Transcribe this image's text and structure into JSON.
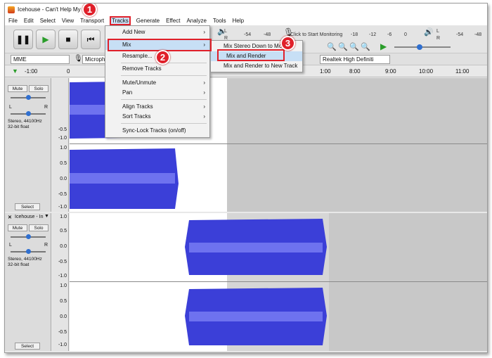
{
  "window": {
    "title": "Icehouse - Can't Help My"
  },
  "menubar": [
    "File",
    "Edit",
    "Select",
    "View",
    "Transport",
    "Tracks",
    "Generate",
    "Effect",
    "Analyze",
    "Tools",
    "Help"
  ],
  "toolbar": {
    "pause_icon": "pause-icon",
    "play_icon": "play-icon",
    "stop_icon": "stop-icon",
    "skip_start_icon": "skip-start-icon",
    "meter_labels": [
      "L",
      "R"
    ],
    "meter_ticks": [
      "-54",
      "-48",
      "-18",
      "-12",
      "-6",
      "0"
    ],
    "meter_ticks_right": [
      "-54",
      "-48"
    ],
    "monitor_text": "Click to Start Monitoring"
  },
  "device_bar": {
    "host": "MME",
    "mic_input": "Microph",
    "output_device": "Realtek High Definiti"
  },
  "ruler": {
    "start": "-1:00",
    "marks": [
      "0",
      "8:00",
      "9:00",
      "10:00",
      "11:00",
      "1:00"
    ]
  },
  "track1": {
    "mute": "Mute",
    "solo": "Solo",
    "pan_l": "L",
    "pan_r": "R",
    "info": "Stereo, 44100Hz\n32-bit float",
    "select": "Select",
    "scale_top": [
      "-0.5",
      "-1.0"
    ],
    "scale_bottom": [
      "1.0",
      "0.5",
      "0.0",
      "-0.5",
      "-1.0"
    ]
  },
  "track2": {
    "name": "Icehouse - In",
    "mute": "Mute",
    "solo": "Solo",
    "pan_l": "L",
    "pan_r": "R",
    "info": "Stereo, 44100Hz\n32-bit float",
    "select": "Select",
    "scale_top": [
      "1.0",
      "0.5",
      "0.0",
      "-0.5",
      "-1.0"
    ],
    "scale_bottom": [
      "1.0",
      "0.5",
      "0.0",
      "-0.5",
      "-1.0"
    ]
  },
  "tracks_menu": {
    "items": [
      {
        "label": "Add New",
        "submenu": true
      },
      {
        "label": "Mix",
        "submenu": true
      },
      {
        "label": "Resample...",
        "submenu": false
      },
      {
        "label": "Remove Tracks",
        "submenu": false
      },
      {
        "label": "Mute/Unmute",
        "submenu": true
      },
      {
        "label": "Pan",
        "submenu": true
      },
      {
        "label": "Align Tracks",
        "submenu": true
      },
      {
        "label": "Sort Tracks",
        "submenu": true
      },
      {
        "label": "Sync-Lock Tracks (on/off)",
        "submenu": false
      }
    ]
  },
  "mix_submenu": {
    "items": [
      "Mix Stereo Down to Mono",
      "Mix and Render",
      "Mix and Render to New Track"
    ]
  },
  "badges": [
    "1",
    "2",
    "3"
  ],
  "colors": {
    "waveform": "#3b3fd8",
    "waveform_light": "#6e72ef",
    "highlight_box": "#e0202a",
    "badge": "#e0202a"
  }
}
